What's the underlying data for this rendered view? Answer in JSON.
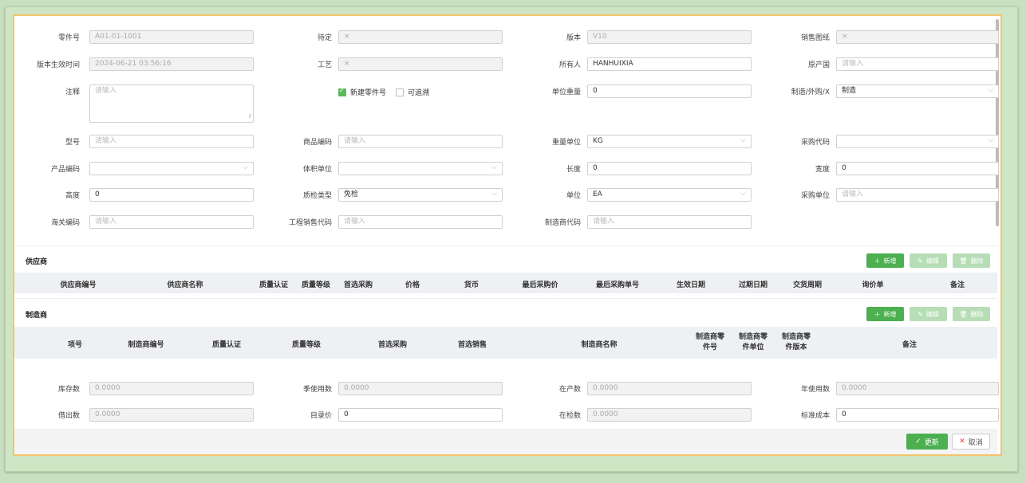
{
  "form": {
    "part_no": {
      "label": "零件号",
      "value": "A01-01-1001"
    },
    "pending": {
      "label": "待定",
      "value": "×"
    },
    "version": {
      "label": "版本",
      "value": "V10"
    },
    "sales_drawing": {
      "label": "销售图纸",
      "value": "×"
    },
    "effective_time": {
      "label": "版本生效时间",
      "value": "2024-06-21 03:56:16"
    },
    "process": {
      "label": "工艺",
      "value": "×"
    },
    "owner": {
      "label": "所有人",
      "value": "HANHUIXIA"
    },
    "origin_country": {
      "label": "原产国",
      "placeholder": "请输入"
    },
    "note": {
      "label": "注释",
      "placeholder": "请输入"
    },
    "new_part_checkbox": "新建零件号",
    "traceable_checkbox": "可追溯",
    "unit_weight": {
      "label": "单位重量",
      "value": "0"
    },
    "make_buy": {
      "label": "制造/外购/X",
      "value": "制造"
    },
    "model": {
      "label": "型号",
      "placeholder": "请输入"
    },
    "product_code": {
      "label": "商品编码",
      "placeholder": "请输入"
    },
    "weight_unit": {
      "label": "重量单位",
      "value": "KG"
    },
    "purchase_code": {
      "label": "采购代码",
      "value": ""
    },
    "product_no": {
      "label": "产品编码",
      "value": ""
    },
    "volume_unit": {
      "label": "体积单位",
      "value": ""
    },
    "length": {
      "label": "长度",
      "value": "0"
    },
    "width": {
      "label": "宽度",
      "value": "0"
    },
    "height": {
      "label": "高度",
      "value": "0"
    },
    "qc_type": {
      "label": "质检类型",
      "value": "免检"
    },
    "unit": {
      "label": "单位",
      "value": "EA"
    },
    "purchase_unit": {
      "label": "采购单位",
      "placeholder": "请输入"
    },
    "customs_code": {
      "label": "海关编码",
      "placeholder": "请输入"
    },
    "eng_sales_code": {
      "label": "工程销售代码",
      "placeholder": "请输入"
    },
    "manufacturer_code": {
      "label": "制造商代码",
      "placeholder": "请输入"
    }
  },
  "supplier": {
    "title": "供应商",
    "add": "新增",
    "edit": "编辑",
    "delete": "删除",
    "columns": [
      "供应商编号",
      "供应商名称",
      "质量认证",
      "质量等级",
      "首选采购",
      "价格",
      "货币",
      "最后采购价",
      "最后采购单号",
      "生效日期",
      "过期日期",
      "交货周期",
      "询价单",
      "备注"
    ]
  },
  "manufacturer": {
    "title": "制造商",
    "add": "新增",
    "edit": "编辑",
    "delete": "删除",
    "columns": [
      "项号",
      "制造商编号",
      "质量认证",
      "质量等级",
      "首选采购",
      "首选销售",
      "制造商名称"
    ],
    "columns_2line": [
      [
        "制造商零",
        "件号"
      ],
      [
        "制造商零",
        "件单位"
      ],
      [
        "制造商零",
        "件版本"
      ]
    ],
    "note_col": "备注"
  },
  "stock": {
    "inventory": {
      "label": "库存数",
      "value": "0.0000"
    },
    "season_use": {
      "label": "季使用数",
      "value": "0.0000"
    },
    "in_production": {
      "label": "在产数",
      "value": "0.0000"
    },
    "annual_use": {
      "label": "年使用数",
      "value": "0.0000"
    },
    "borrowed": {
      "label": "借出数",
      "value": "0.0000"
    },
    "catalog_price": {
      "label": "目录价",
      "value": "0"
    },
    "in_inspection": {
      "label": "在检数",
      "value": "0.0000"
    },
    "standard_cost": {
      "label": "标准成本",
      "value": "0"
    }
  },
  "footer": {
    "update": "更新",
    "cancel": "取消"
  }
}
